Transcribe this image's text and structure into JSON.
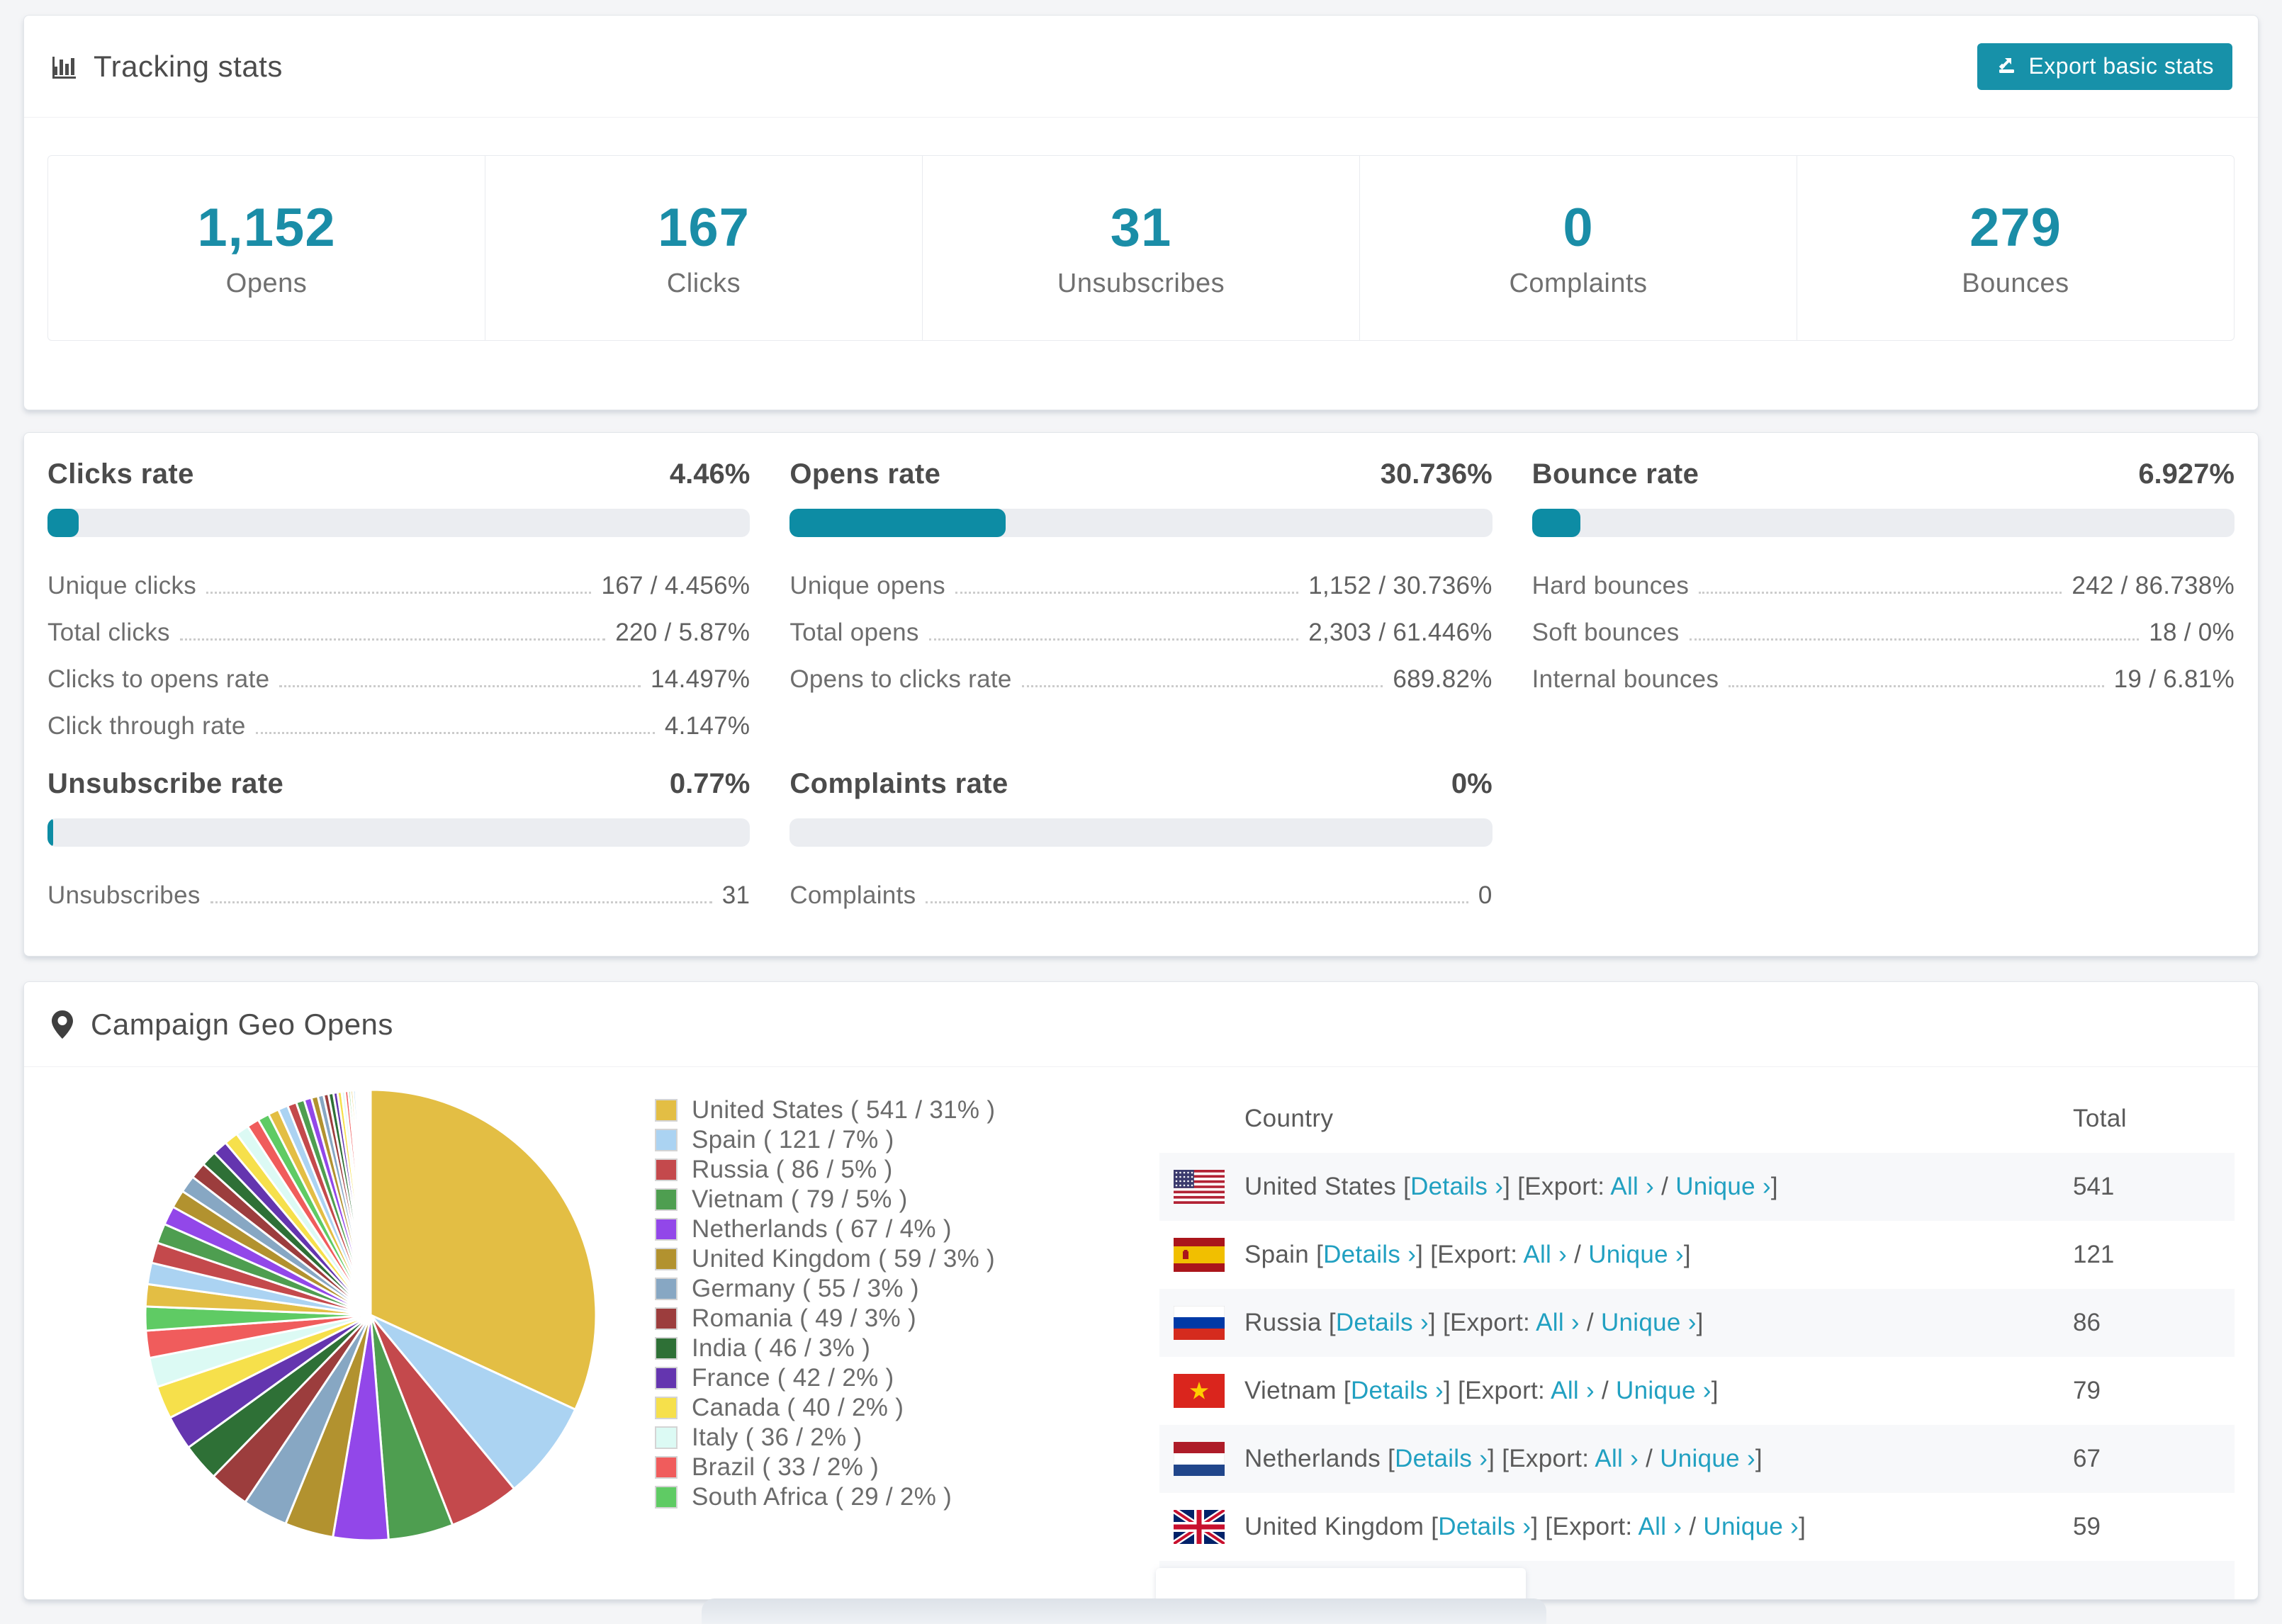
{
  "tracking": {
    "title": "Tracking stats",
    "export_button": "Export basic stats",
    "stats": [
      {
        "value": "1,152",
        "label": "Opens"
      },
      {
        "value": "167",
        "label": "Clicks"
      },
      {
        "value": "31",
        "label": "Unsubscribes"
      },
      {
        "value": "0",
        "label": "Complaints"
      },
      {
        "value": "279",
        "label": "Bounces"
      }
    ]
  },
  "rates": {
    "accent_color": "#0d8ca4",
    "blocks": [
      {
        "title": "Clicks rate",
        "value": "4.46%",
        "pct": 4.46,
        "rows": [
          {
            "label": "Unique clicks",
            "value": "167 / 4.456%"
          },
          {
            "label": "Total clicks",
            "value": "220 / 5.87%"
          },
          {
            "label": "Clicks to opens rate",
            "value": "14.497%"
          },
          {
            "label": "Click through rate",
            "value": "4.147%"
          }
        ]
      },
      {
        "title": "Opens rate",
        "value": "30.736%",
        "pct": 30.736,
        "rows": [
          {
            "label": "Unique opens",
            "value": "1,152 / 30.736%"
          },
          {
            "label": "Total opens",
            "value": "2,303 / 61.446%"
          },
          {
            "label": "Opens to clicks rate",
            "value": "689.82%"
          }
        ]
      },
      {
        "title": "Bounce rate",
        "value": "6.927%",
        "pct": 6.927,
        "rows": [
          {
            "label": "Hard bounces",
            "value": "242 / 86.738%"
          },
          {
            "label": "Soft bounces",
            "value": "18 / 0%"
          },
          {
            "label": "Internal bounces",
            "value": "19 / 6.81%"
          }
        ]
      },
      {
        "title": "Unsubscribe rate",
        "value": "0.77%",
        "pct": 0.77,
        "rows": [
          {
            "label": "Unsubscribes",
            "value": "31"
          }
        ]
      },
      {
        "title": "Complaints rate",
        "value": "0%",
        "pct": 0,
        "rows": [
          {
            "label": "Complaints",
            "value": "0"
          }
        ]
      }
    ]
  },
  "geo": {
    "title": "Campaign Geo Opens",
    "table": {
      "headers": {
        "country": "Country",
        "total": "Total"
      },
      "links": {
        "lb": "[",
        "rb": "]",
        "details": "Details",
        "arrow": "›",
        "export": "Export:",
        "all": "All",
        "unique": "Unique",
        "slash": "/"
      },
      "rows": [
        {
          "name": "United States",
          "flag": "us",
          "total": "541"
        },
        {
          "name": "Spain",
          "flag": "es",
          "total": "121"
        },
        {
          "name": "Russia",
          "flag": "ru",
          "total": "86"
        },
        {
          "name": "Vietnam",
          "flag": "vn",
          "total": "79"
        },
        {
          "name": "Netherlands",
          "flag": "nl",
          "total": "67"
        },
        {
          "name": "United Kingdom",
          "flag": "gb",
          "total": "59"
        }
      ],
      "partial_row": {
        "flag": "de"
      }
    }
  },
  "chart_data": {
    "type": "pie",
    "title": "Campaign Geo Opens",
    "unit": "opens",
    "start_angle_deg": -90,
    "direction": "clockwise",
    "legend_position": "right",
    "legend_label_format": "{name} ( {value} / {pct}% )",
    "series": [
      {
        "name": "United States",
        "value": 541,
        "pct": 31,
        "color": "#E3BE44"
      },
      {
        "name": "Spain",
        "value": 121,
        "pct": 7,
        "color": "#ABD3F2"
      },
      {
        "name": "Russia",
        "value": 86,
        "pct": 5,
        "color": "#C4494C"
      },
      {
        "name": "Vietnam",
        "value": 79,
        "pct": 5,
        "color": "#4E9E50"
      },
      {
        "name": "Netherlands",
        "value": 67,
        "pct": 4,
        "color": "#9247E9"
      },
      {
        "name": "United Kingdom",
        "value": 59,
        "pct": 3,
        "color": "#B2922F"
      },
      {
        "name": "Germany",
        "value": 55,
        "pct": 3,
        "color": "#87A7C3"
      },
      {
        "name": "Romania",
        "value": 49,
        "pct": 3,
        "color": "#9C3D3D"
      },
      {
        "name": "India",
        "value": 46,
        "pct": 3,
        "color": "#2E7036"
      },
      {
        "name": "France",
        "value": 42,
        "pct": 2,
        "color": "#6435AF"
      },
      {
        "name": "Canada",
        "value": 40,
        "pct": 2,
        "color": "#F6E04B"
      },
      {
        "name": "Italy",
        "value": 36,
        "pct": 2,
        "color": "#DCFAF4"
      },
      {
        "name": "Brazil",
        "value": 33,
        "pct": 2,
        "color": "#F05C5C"
      },
      {
        "name": "South Africa",
        "value": 29,
        "pct": 2,
        "color": "#5FCB64"
      }
    ],
    "others_values": [
      27,
      26,
      25,
      24,
      23,
      22,
      21,
      20,
      19,
      18,
      17,
      16,
      15,
      14,
      13,
      12,
      11,
      10,
      9,
      8,
      7,
      6,
      6,
      5,
      5,
      4,
      4,
      3,
      3,
      3,
      2,
      2,
      2,
      2,
      1,
      1,
      1,
      1,
      1,
      1,
      1,
      1,
      1,
      1
    ],
    "palette": [
      "#E3BE44",
      "#ABD3F2",
      "#C4494C",
      "#4E9E50",
      "#9247E9",
      "#B2922F",
      "#87A7C3",
      "#9C3D3D",
      "#2E7036",
      "#6435AF",
      "#F6E04B",
      "#DCFAF4",
      "#F05C5C",
      "#5FCB64"
    ]
  }
}
